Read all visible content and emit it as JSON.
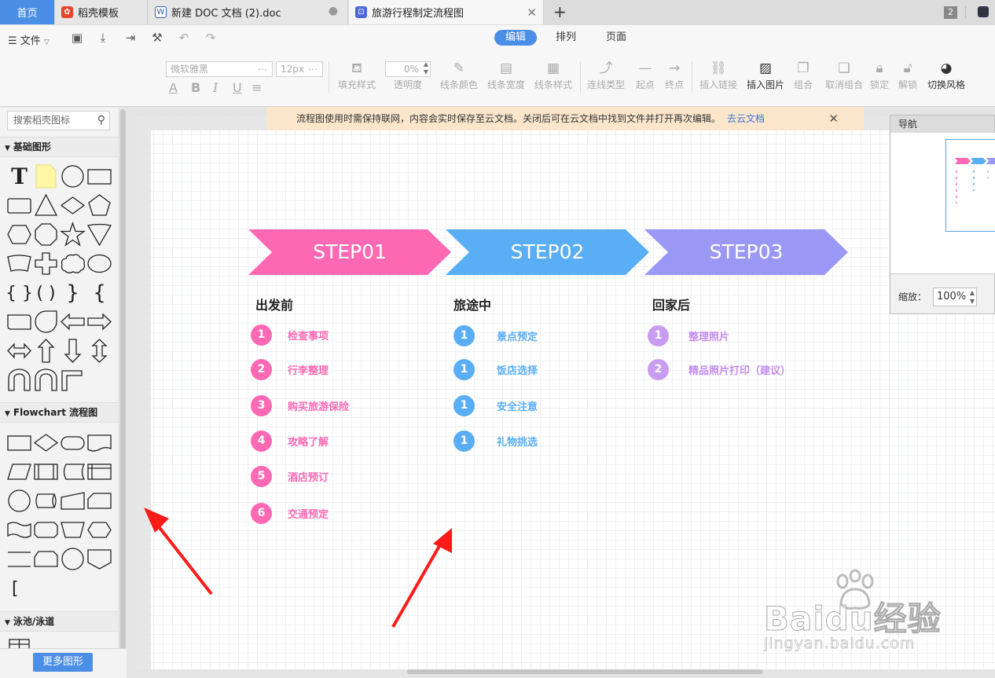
{
  "tabs": [
    {
      "label": "首页"
    },
    {
      "label": "稻壳模板"
    },
    {
      "label": "新建 DOC 文档 (2).doc"
    },
    {
      "label": "旅游行程制定流程图"
    }
  ],
  "window": {
    "tab_count": "2",
    "new_tab": "+"
  },
  "toolbar": {
    "file_label": "文件",
    "modes": [
      "编辑",
      "排列",
      "页面"
    ],
    "font_name": "微软雅黑",
    "font_size": "12px",
    "opacity_value": "0%",
    "tools": [
      "填充样式",
      "透明度",
      "线条颜色",
      "线条宽度",
      "线条样式",
      "连线类型",
      "起点",
      "终点",
      "插入链接",
      "插入图片",
      "组合",
      "取消组合",
      "锁定",
      "解锁",
      "切换风格"
    ],
    "format": [
      "A",
      "B",
      "I",
      "U"
    ]
  },
  "sidebar": {
    "search_placeholder": "搜索稻壳图标",
    "sections": [
      "基础图形",
      "Flowchart 流程图",
      "泳池/泳道"
    ],
    "more_label": "更多图形"
  },
  "notice": {
    "text": "流程图使用时需保持联网，内容会实时保存至云文档。关闭后可在云文档中找到文件并打开再次编辑。",
    "link": "去云文档"
  },
  "colors": {
    "step1": "#ff69b4",
    "step2": "#5aaef5",
    "step3": "#9b97f5",
    "accent": "#4a8ee6"
  },
  "diagram": {
    "steps": [
      "STEP01",
      "STEP02",
      "STEP03"
    ],
    "columns": [
      {
        "title": "出发前",
        "items": [
          {
            "n": "1",
            "t": "检查事项"
          },
          {
            "n": "2",
            "t": "行李整理"
          },
          {
            "n": "3",
            "t": "购买旅游保险"
          },
          {
            "n": "4",
            "t": "攻略了解"
          },
          {
            "n": "5",
            "t": "酒店预订"
          },
          {
            "n": "6",
            "t": "交通预定"
          }
        ]
      },
      {
        "title": "旅途中",
        "items": [
          {
            "n": "1",
            "t": "景点预定"
          },
          {
            "n": "1",
            "t": "饭店选择"
          },
          {
            "n": "1",
            "t": "安全注意"
          },
          {
            "n": "1",
            "t": "礼物挑选"
          }
        ]
      },
      {
        "title": "回家后",
        "items": [
          {
            "n": "1",
            "t": "整理照片"
          },
          {
            "n": "2",
            "t": "精品照片打印（建议）"
          }
        ]
      }
    ]
  },
  "navigator": {
    "title": "导航",
    "zoom_label": "缩放：",
    "zoom_value": "100%"
  },
  "watermark": {
    "brand": "Baidu经验",
    "url": "jingyan.baidu.com"
  }
}
